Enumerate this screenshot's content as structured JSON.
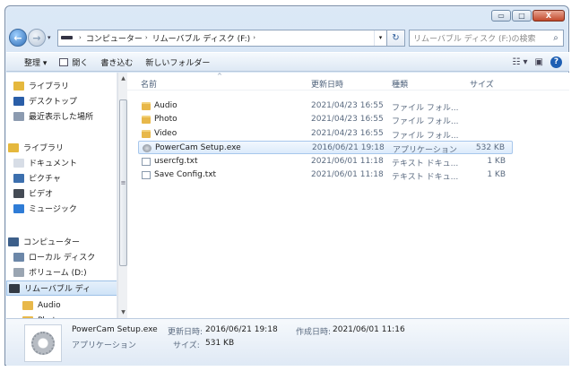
{
  "window": {
    "controls": {
      "minimize": "▭",
      "maximize": "□",
      "close": "X"
    }
  },
  "address": {
    "separator": "›",
    "segments": [
      "コンピューター",
      "リムーバブル ディスク (F:)"
    ],
    "dropdown": "▾"
  },
  "nav_buttons": {
    "back": "←",
    "forward": "→",
    "history": "▾",
    "refresh": "↻"
  },
  "search": {
    "placeholder": "リムーバブル ディスク (F:)の検索",
    "icon": "magnifier-icon"
  },
  "toolbar": {
    "organize": "整理 ▾",
    "open": "開く",
    "burn": "書き込む",
    "new_folder": "新しいフォルダー",
    "view": "☷ ▾",
    "preview": "▣",
    "help": "?"
  },
  "nav_pane": {
    "items": [
      {
        "label": "ライブラリ",
        "icon": "library-icon",
        "color": "#e5b83d"
      },
      {
        "label": "デスクトップ",
        "icon": "desktop-icon",
        "color": "#2a5ea8"
      },
      {
        "label": "最近表示した場所",
        "icon": "recent-places-icon",
        "color": "#8c9bb0"
      },
      {
        "label": "ライブラリ",
        "icon": "libraries-icon",
        "color": "#e5b83d"
      },
      {
        "label": "ドキュメント",
        "icon": "documents-icon",
        "color": "#d7dde6"
      },
      {
        "label": "ピクチャ",
        "icon": "pictures-icon",
        "color": "#3c6fae"
      },
      {
        "label": "ビデオ",
        "icon": "videos-icon",
        "color": "#444b55"
      },
      {
        "label": "ミュージック",
        "icon": "music-icon",
        "color": "#2f7cd6"
      },
      {
        "label": "コンピューター",
        "icon": "computer-icon",
        "color": "#3d5f8a"
      },
      {
        "label": "ローカル ディスク",
        "icon": "local-disk-icon",
        "color": "#6c87a8"
      },
      {
        "label": "ボリューム (D:)",
        "icon": "volume-icon",
        "color": "#9aa5b2"
      },
      {
        "label": "リムーバブル ディ",
        "icon": "removable-disk-icon",
        "color": "#333a44"
      },
      {
        "label": "Audio",
        "icon": "folder-icon",
        "color": "#e8b84a"
      },
      {
        "label": "Photo",
        "icon": "folder-icon",
        "color": "#e8b84a"
      }
    ],
    "scroll_grip": "≡"
  },
  "columns": {
    "name": "名前",
    "modified": "更新日時",
    "type": "種類",
    "size": "サイズ",
    "sort_indicator": "^"
  },
  "files": [
    {
      "name": "Audio",
      "modified": "2021/04/23 16:55",
      "type": "ファイル フォル...",
      "size": "",
      "icon": "folder-icon"
    },
    {
      "name": "Photo",
      "modified": "2021/04/23 16:55",
      "type": "ファイル フォル...",
      "size": "",
      "icon": "folder-icon"
    },
    {
      "name": "Video",
      "modified": "2021/04/23 16:55",
      "type": "ファイル フォル...",
      "size": "",
      "icon": "folder-icon"
    },
    {
      "name": "PowerCam Setup.exe",
      "modified": "2016/06/21 19:18",
      "type": "アプリケーション",
      "size": "532 KB",
      "icon": "application-icon",
      "selected": true
    },
    {
      "name": "usercfg.txt",
      "modified": "2021/06/01 11:18",
      "type": "テキスト ドキュ...",
      "size": "1 KB",
      "icon": "text-file-icon"
    },
    {
      "name": "Save Config.txt",
      "modified": "2021/06/01 11:18",
      "type": "テキスト ドキュ...",
      "size": "1 KB",
      "icon": "text-file-icon"
    }
  ],
  "details": {
    "filename": "PowerCam Setup.exe",
    "modified_label": "更新日時:",
    "modified_value": "2016/06/21 19:18",
    "created_label": "作成日時:",
    "created_value": "2021/06/01 11:16",
    "type": "アプリケーション",
    "size_label": "サイズ:",
    "size_value": "531 KB"
  }
}
